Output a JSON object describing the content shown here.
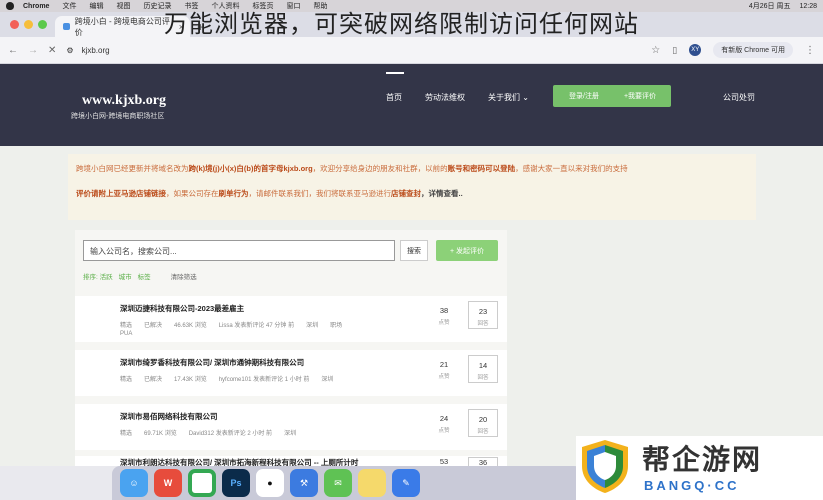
{
  "overlay_title": "万能浏览器，可突破网络限制访问任何网站",
  "menubar": {
    "app": "Chrome",
    "items": [
      "文件",
      "编辑",
      "视图",
      "历史记录",
      "书签",
      "个人资料",
      "标签页",
      "窗口",
      "帮助"
    ],
    "datetime": "4月26日 周五",
    "time": "12:28"
  },
  "tab": {
    "title": "跨境小白 - 跨境电商公司评价"
  },
  "address": {
    "url": "kjxb.org",
    "avatar": "XY",
    "update_label": "有新版 Chrome 可用"
  },
  "site": {
    "logo": "www.kjxb.org",
    "tagline": "跨境小白网-跨境电商职场社区",
    "nav": [
      "首页",
      "劳动法维权",
      "关于我们"
    ],
    "login_button": "登录/注册",
    "review_button": "+我要评价",
    "punish_label": "公司处罚"
  },
  "notice": {
    "line1_a": "跨境小白网已经更新并将域名改为",
    "line1_b": "跨(k)境(j)小(x)白(b)的首字母kjxb.org",
    "line1_c": "，欢迎分享给身边的朋友和社群，以前的",
    "line1_d": "账号和密码可以登陆",
    "line1_e": "，感谢大家一直以来对我们的支持",
    "line2_a": "评价请附上亚马逊店铺链接",
    "line2_b": "，如果公司存在",
    "line2_c": "刷单行为",
    "line2_d": "，请邮件联系我们，我们将联系亚马逊进行",
    "line2_e": "店铺查封",
    "line2_f": "，详情查看.."
  },
  "search": {
    "placeholder": "输入公司名，搜索公司...",
    "button": "搜索",
    "review_button": "+ 发起评价",
    "filters": [
      "排序: 活跃",
      "城市",
      "标签"
    ],
    "reset": "清除筛选"
  },
  "companies": [
    {
      "name": "深圳迈捷科技有限公司-2023最差雇主",
      "tag": "精选",
      "status": "已解决",
      "views": "46.63K 浏览",
      "activity": "Lissa 发表新评论 47 分钟 前",
      "city": "深圳",
      "category": "职场",
      "extra": "PUA",
      "count": "38",
      "count_label": "点赞",
      "answers": "23",
      "answers_label": "回答"
    },
    {
      "name": "深圳市绮罗香科技有限公司/ 深圳市通钟期科技有限公司",
      "tag": "精选",
      "status": "已解决",
      "views": "17.43K 浏览",
      "activity": "hyfcome101 发表新评论 1 小时 前",
      "city": "深圳",
      "category": "",
      "extra": "",
      "count": "21",
      "count_label": "点赞",
      "answers": "14",
      "answers_label": "回答"
    },
    {
      "name": "深圳市易佰网络科技有限公司",
      "tag": "精选",
      "status": "",
      "views": "69.71K 浏览",
      "activity": "David312 发表新评论 2 小时 前",
      "city": "深圳",
      "category": "",
      "extra": "",
      "count": "24",
      "count_label": "点赞",
      "answers": "20",
      "answers_label": "回答"
    },
    {
      "name": "深圳市利朗达科技有限公司/ 深圳市拓海新程科技有限公司 -- 上厕所计时",
      "tag": "",
      "status": "",
      "views": "",
      "activity": "",
      "city": "",
      "category": "",
      "extra": "",
      "count": "53",
      "count_label": "",
      "answers": "36",
      "answers_label": ""
    }
  ],
  "dock": [
    "Finder",
    "WPS",
    "Chrome",
    "Ps",
    "QQ",
    "Xcode",
    "WeChat",
    "Notes",
    "Pages"
  ],
  "watermark": {
    "text": "帮企游网",
    "sub": "BANGQ·CC"
  },
  "colors": {
    "header_bg": "#333548",
    "accent_green": "#77c16a",
    "notice_text": "#c96b3b"
  }
}
